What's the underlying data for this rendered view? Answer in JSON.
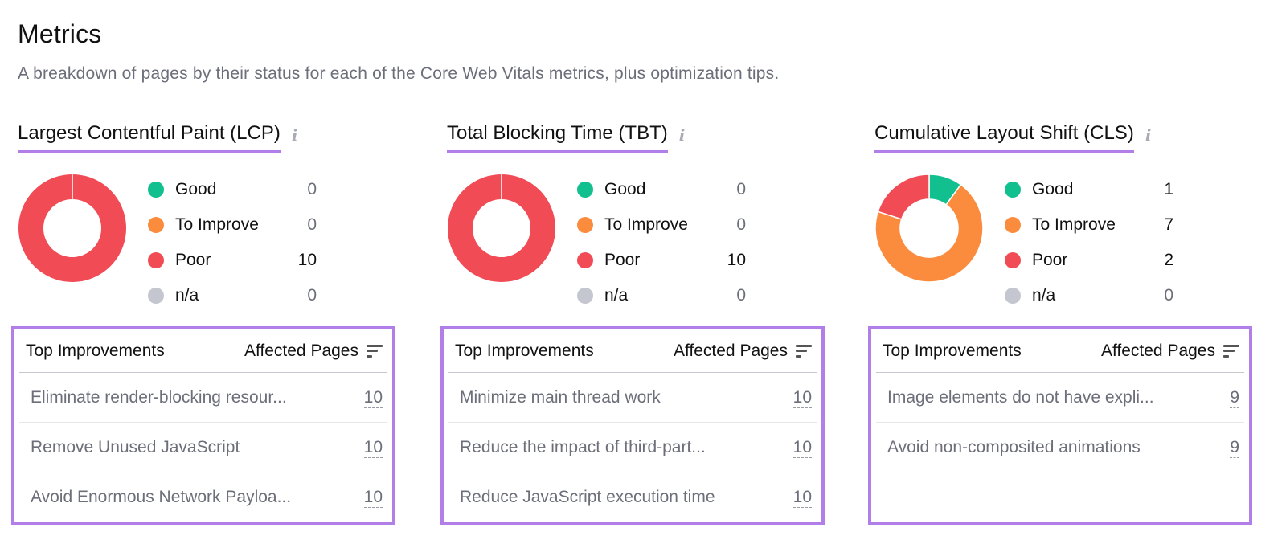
{
  "header": {
    "title": "Metrics",
    "subtitle": "A breakdown of pages by their status for each of the Core Web Vitals metrics, plus optimization tips."
  },
  "colors": {
    "good": "#12bf8f",
    "to_improve": "#fb8c3e",
    "poor": "#f14b55",
    "na": "#c4c7cf",
    "highlight": "#b27fe8"
  },
  "table_headers": {
    "col_a": "Top Improvements",
    "col_b": "Affected Pages"
  },
  "metrics": [
    {
      "title": "Largest Contentful Paint (LCP)",
      "legend": [
        {
          "key": "good",
          "label": "Good",
          "value": 0
        },
        {
          "key": "to_improve",
          "label": "To Improve",
          "value": 0
        },
        {
          "key": "poor",
          "label": "Poor",
          "value": 10
        },
        {
          "key": "na",
          "label": "n/a",
          "value": 0
        }
      ],
      "improvements": [
        {
          "name": "Eliminate render-blocking resour...",
          "count": "10"
        },
        {
          "name": "Remove Unused JavaScript",
          "count": "10"
        },
        {
          "name": "Avoid Enormous Network Payloa...",
          "count": "10"
        }
      ]
    },
    {
      "title": "Total Blocking Time (TBT)",
      "legend": [
        {
          "key": "good",
          "label": "Good",
          "value": 0
        },
        {
          "key": "to_improve",
          "label": "To Improve",
          "value": 0
        },
        {
          "key": "poor",
          "label": "Poor",
          "value": 10
        },
        {
          "key": "na",
          "label": "n/a",
          "value": 0
        }
      ],
      "improvements": [
        {
          "name": "Minimize main thread work",
          "count": "10"
        },
        {
          "name": "Reduce the impact of third-part...",
          "count": "10"
        },
        {
          "name": "Reduce JavaScript execution time",
          "count": "10"
        }
      ]
    },
    {
      "title": "Cumulative Layout Shift (CLS)",
      "legend": [
        {
          "key": "good",
          "label": "Good",
          "value": 1
        },
        {
          "key": "to_improve",
          "label": "To Improve",
          "value": 7
        },
        {
          "key": "poor",
          "label": "Poor",
          "value": 2
        },
        {
          "key": "na",
          "label": "n/a",
          "value": 0
        }
      ],
      "improvements": [
        {
          "name": "Image elements do not have expli...",
          "count": "9"
        },
        {
          "name": "Avoid non-composited animations",
          "count": "9"
        }
      ]
    }
  ],
  "chart_data": [
    {
      "type": "pie",
      "title": "Largest Contentful Paint (LCP)",
      "categories": [
        "Good",
        "To Improve",
        "Poor",
        "n/a"
      ],
      "values": [
        0,
        0,
        10,
        0
      ]
    },
    {
      "type": "pie",
      "title": "Total Blocking Time (TBT)",
      "categories": [
        "Good",
        "To Improve",
        "Poor",
        "n/a"
      ],
      "values": [
        0,
        0,
        10,
        0
      ]
    },
    {
      "type": "pie",
      "title": "Cumulative Layout Shift (CLS)",
      "categories": [
        "Good",
        "To Improve",
        "Poor",
        "n/a"
      ],
      "values": [
        1,
        7,
        2,
        0
      ]
    }
  ]
}
